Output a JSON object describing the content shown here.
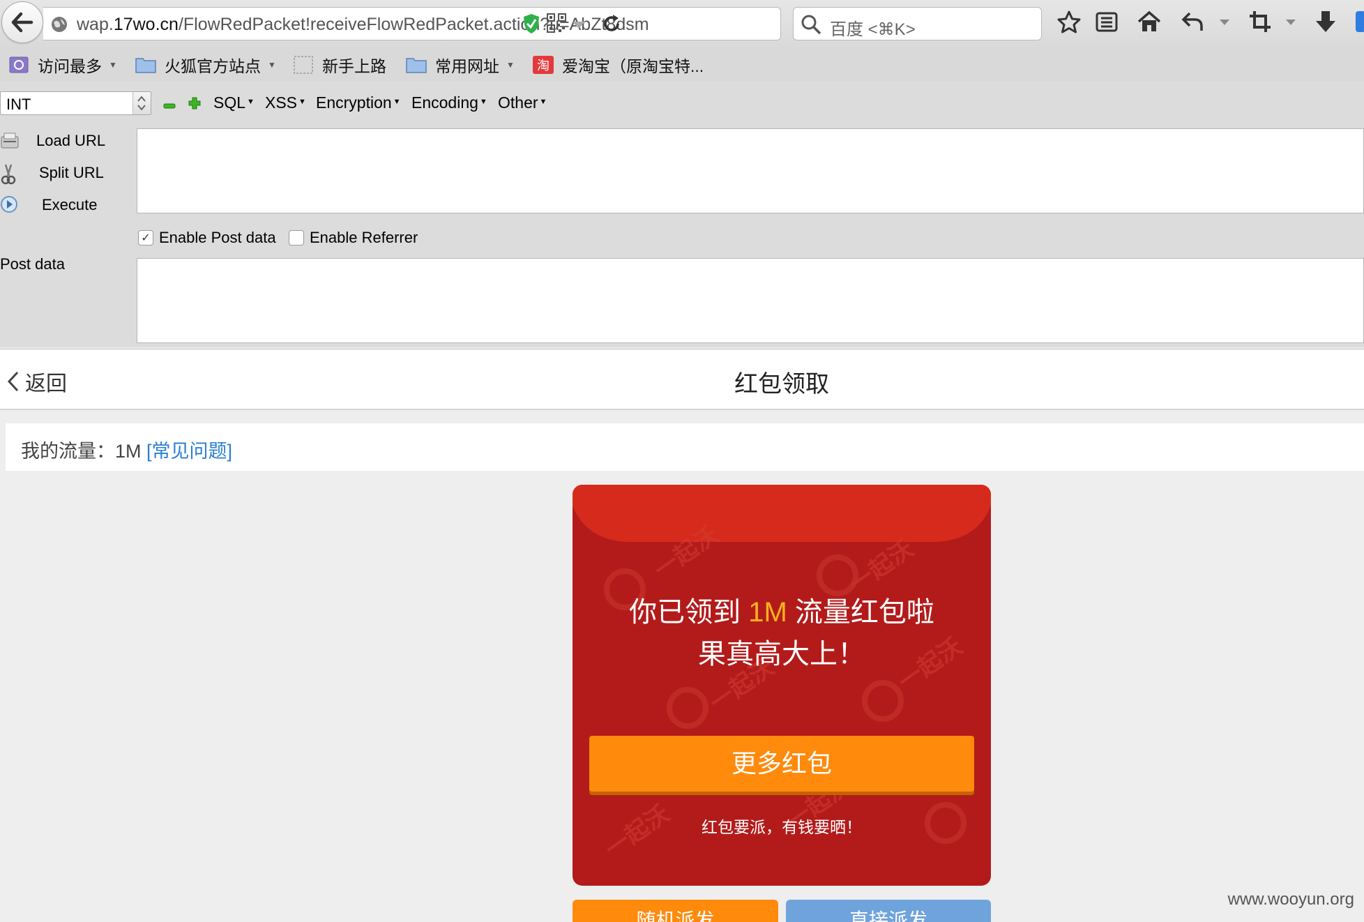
{
  "browser": {
    "url_prefix": "wap.",
    "url_host": "17wo.cn",
    "url_path": "/FlowRedPacket!receiveFlowRedPacket.action?u=AbZt8dsm",
    "search_placeholder": "百度 <⌘K>"
  },
  "bookmarks": [
    {
      "label": "访问最多",
      "has_menu": true
    },
    {
      "label": "火狐官方站点",
      "has_menu": true
    },
    {
      "label": "新手上路",
      "has_menu": false
    },
    {
      "label": "常用网址",
      "has_menu": true
    },
    {
      "label": "爱淘宝（原淘宝特...",
      "has_menu": false
    }
  ],
  "hackbar": {
    "select_value": "INT",
    "menus": [
      "SQL",
      "XSS",
      "Encryption",
      "Encoding",
      "Other"
    ],
    "load_url": "Load URL",
    "split_url": "Split URL",
    "execute": "Execute",
    "enable_post": "Enable Post data",
    "enable_post_checked": true,
    "enable_referrer": "Enable Referrer",
    "enable_referrer_checked": false,
    "post_label": "Post data",
    "url_value": "",
    "post_value": ""
  },
  "page": {
    "back_label": "返回",
    "title": "红包领取",
    "flow_label": "我的流量：",
    "flow_value": "1M",
    "faq_link": "[常见问题]"
  },
  "packet": {
    "msg_before": "你已领到 ",
    "amount": "1M",
    "msg_after": " 流量红包啦",
    "msg_line2": "果真高大上！",
    "more_button": "更多红包",
    "slogan": "红包要派，有钱要晒！",
    "watermark_text": "一起沃",
    "bg_color": "#b31b1b",
    "flap_color": "#d62b1c",
    "accent_color": "#ffb21e",
    "button_color": "#ff8a0c"
  },
  "dispatch": {
    "random_label": "随机派发",
    "direct_label": "直接派发"
  },
  "site_watermark": "www.wooyun.org"
}
